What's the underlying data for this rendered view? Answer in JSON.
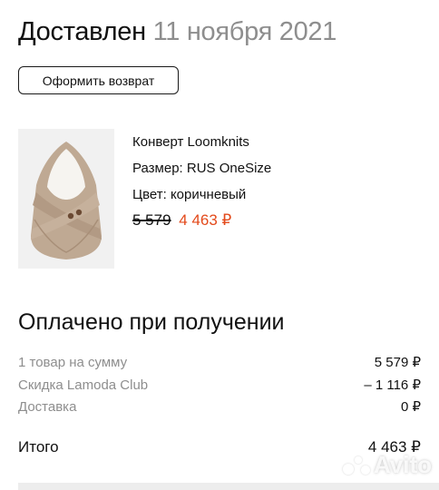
{
  "header": {
    "status": "Доставлен",
    "date": "11 ноября 2021"
  },
  "actions": {
    "return_label": "Оформить возврат"
  },
  "product": {
    "name": "Конверт Loomknits",
    "size": "Размер: RUS OneSize",
    "color": "Цвет: коричневый",
    "price_old": "5 579",
    "price_new": "4 463 ₽"
  },
  "payment": {
    "title": "Оплачено при получении",
    "rows": [
      {
        "label": "1 товар на сумму",
        "value": "5 579 ₽"
      },
      {
        "label": "Скидка Lamoda Club",
        "value": "– 1 116 ₽"
      },
      {
        "label": "Доставка",
        "value": "0 ₽"
      }
    ],
    "total_label": "Итого",
    "total_value": "4 463 ₽"
  },
  "watermark": {
    "text": "Avito"
  },
  "colors": {
    "accent_price": "#e34a1b",
    "muted_text": "#8e8e8e",
    "text": "#111111"
  }
}
